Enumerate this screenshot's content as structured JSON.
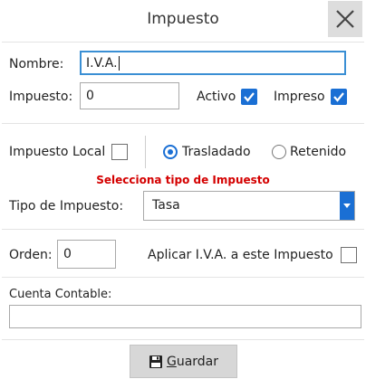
{
  "dialog": {
    "title": "Impuesto",
    "close_icon": "close-icon"
  },
  "fields": {
    "nombre_label": "Nombre:",
    "nombre_value": "I.V.A.",
    "impuesto_label": "Impuesto:",
    "impuesto_value": "0",
    "activo_label": "Activo",
    "activo_checked": true,
    "impreso_label": "Impreso",
    "impreso_checked": true,
    "impuesto_local_label": "Impuesto Local",
    "impuesto_local_checked": false,
    "trasladado_label": "Trasladado",
    "trasladado_selected": true,
    "retenido_label": "Retenido",
    "retenido_selected": false,
    "hint": "Selecciona tipo de Impuesto",
    "tipo_label": "Tipo de Impuesto:",
    "tipo_value": "Tasa",
    "orden_label": "Orden:",
    "orden_value": "0",
    "aplicar_label": "Aplicar I.V.A. a este Impuesto",
    "aplicar_checked": false,
    "cuenta_label": "Cuenta Contable:",
    "cuenta_value": ""
  },
  "footer": {
    "save_label_first": "G",
    "save_label_rest": "uardar",
    "save_icon": "floppy-disk-icon"
  },
  "colors": {
    "accent": "#1a6fd4",
    "hint": "#d40000",
    "focus_border": "#3a8fd4"
  }
}
